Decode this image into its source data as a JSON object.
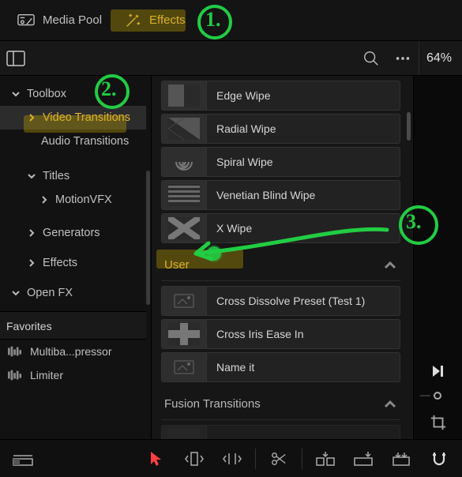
{
  "tabs": {
    "media_pool": "Media Pool",
    "effects": "Effects"
  },
  "zoom": "64%",
  "sidebar": {
    "toolbox": "Toolbox",
    "video_transitions": "Video Transitions",
    "audio_transitions": "Audio Transitions",
    "titles": "Titles",
    "motionvfx": "MotionVFX",
    "generators": "Generators",
    "effects": "Effects",
    "openfx": "Open FX"
  },
  "favorites": {
    "header": "Favorites",
    "items": [
      "Multiba...pressor",
      "Limiter"
    ]
  },
  "groups": {
    "user": "User",
    "fusion": "Fusion Transitions"
  },
  "wipes": [
    {
      "name": "Edge Wipe",
      "icon": "edge"
    },
    {
      "name": "Radial Wipe",
      "icon": "radial"
    },
    {
      "name": "Spiral Wipe",
      "icon": "spiral"
    },
    {
      "name": "Venetian Blind Wipe",
      "icon": "venetian"
    },
    {
      "name": "X Wipe",
      "icon": "xwipe"
    }
  ],
  "user_presets": [
    {
      "name": "Cross Dissolve Preset (Test 1)",
      "icon": "dissolve"
    },
    {
      "name": "Cross Iris Ease In",
      "icon": "cross"
    },
    {
      "name": "Name it",
      "icon": "dissolve"
    }
  ],
  "annotations": {
    "n1": "1.",
    "n2": "2.",
    "n3": "3."
  }
}
